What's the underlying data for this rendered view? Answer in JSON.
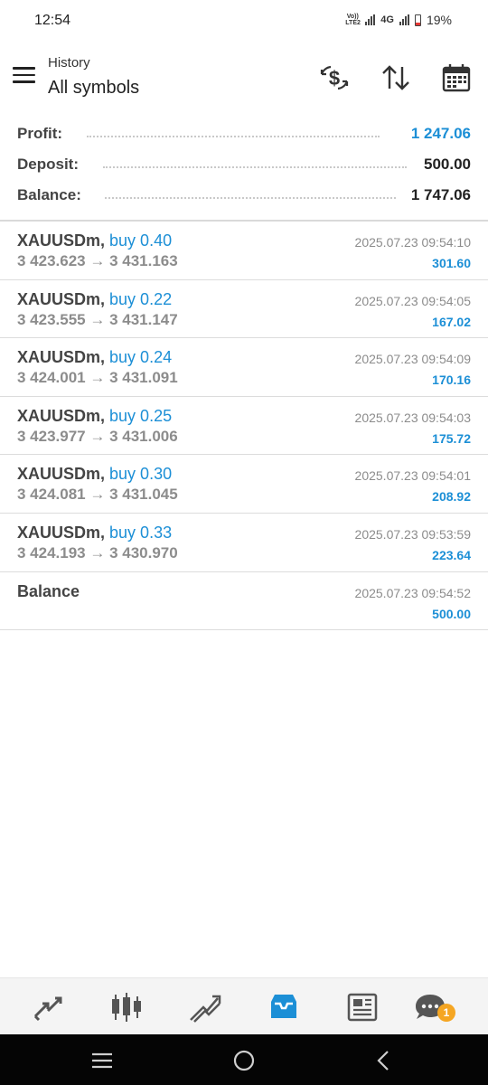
{
  "status_bar": {
    "time": "12:54",
    "volte_top": "Vo))",
    "volte_bottom": "LTE2",
    "network": "4G",
    "battery": "19%"
  },
  "header": {
    "subtitle": "History",
    "title": "All symbols",
    "icons": [
      "currency-exchange-icon",
      "sort-icon",
      "calendar-icon"
    ]
  },
  "summary": [
    {
      "label": "Profit:",
      "value": "1 247.06",
      "color": "#1c8fd6"
    },
    {
      "label": "Deposit:",
      "value": "500.00",
      "color": "#222222"
    },
    {
      "label": "Balance:",
      "value": "1 747.06",
      "color": "#222222"
    }
  ],
  "trades": [
    {
      "symbol": "XAUUSDm,",
      "action": "buy 0.40",
      "prices": "3 423.623 → 3 431.163",
      "time": "2025.07.23 09:54:10",
      "profit": "301.60"
    },
    {
      "symbol": "XAUUSDm,",
      "action": "buy 0.22",
      "prices": "3 423.555 → 3 431.147",
      "time": "2025.07.23 09:54:05",
      "profit": "167.02"
    },
    {
      "symbol": "XAUUSDm,",
      "action": "buy 0.24",
      "prices": "3 424.001 → 3 431.091",
      "time": "2025.07.23 09:54:09",
      "profit": "170.16"
    },
    {
      "symbol": "XAUUSDm,",
      "action": "buy 0.25",
      "prices": "3 423.977 → 3 431.006",
      "time": "2025.07.23 09:54:03",
      "profit": "175.72"
    },
    {
      "symbol": "XAUUSDm,",
      "action": "buy 0.30",
      "prices": "3 424.081 → 3 431.045",
      "time": "2025.07.23 09:54:01",
      "profit": "208.92"
    },
    {
      "symbol": "XAUUSDm,",
      "action": "buy 0.33",
      "prices": "3 424.193 → 3 430.970",
      "time": "2025.07.23 09:53:59",
      "profit": "223.64"
    }
  ],
  "balance_entry": {
    "label": "Balance",
    "time": "2025.07.23 09:54:52",
    "amount": "500.00"
  },
  "bottom_nav": {
    "items": [
      "quotes-icon",
      "chart-icon",
      "trade-icon",
      "history-icon",
      "news-icon",
      "chat-icon"
    ],
    "active": "history-icon",
    "active_color": "#1c8fd6",
    "chat_badge": "1"
  },
  "system_nav": [
    "recents-icon",
    "home-icon",
    "back-icon"
  ]
}
